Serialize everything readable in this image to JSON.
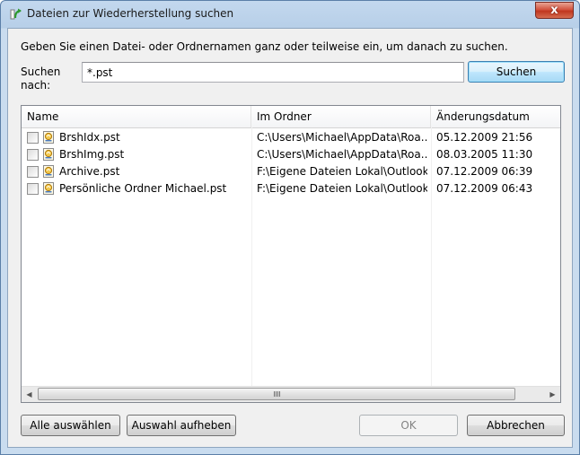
{
  "window": {
    "title": "Dateien zur Wiederherstellung suchen",
    "close_glyph": "x"
  },
  "instruction": "Geben Sie einen Datei- oder Ordnernamen ganz oder teilweise ein, um danach zu suchen.",
  "search": {
    "label": "Suchen nach:",
    "value": "*.pst",
    "button": "Suchen"
  },
  "list": {
    "columns": [
      "Name",
      "Im Ordner",
      "Änderungsdatum"
    ],
    "rows": [
      {
        "name": "BrshIdx.pst",
        "folder": "C:\\Users\\Michael\\AppData\\Roa...",
        "date": "05.12.2009 21:56",
        "checked": false
      },
      {
        "name": "BrshImg.pst",
        "folder": "C:\\Users\\Michael\\AppData\\Roa...",
        "date": "08.03.2005 11:30",
        "checked": false
      },
      {
        "name": "Archive.pst",
        "folder": "F:\\Eigene Dateien Lokal\\Outlook",
        "date": "07.12.2009 06:39",
        "checked": false
      },
      {
        "name": "Persönliche Ordner Michael.pst",
        "folder": "F:\\Eigene Dateien Lokal\\Outlook",
        "date": "07.12.2009 06:43",
        "checked": false
      }
    ]
  },
  "buttons": {
    "select_all": "Alle auswählen",
    "deselect": "Auswahl aufheben",
    "ok": "OK",
    "cancel": "Abbrechen"
  },
  "icons": {
    "app": "restore-icon",
    "file": "pst-file-icon",
    "scroll_left": "◀",
    "scroll_right": "▶"
  }
}
